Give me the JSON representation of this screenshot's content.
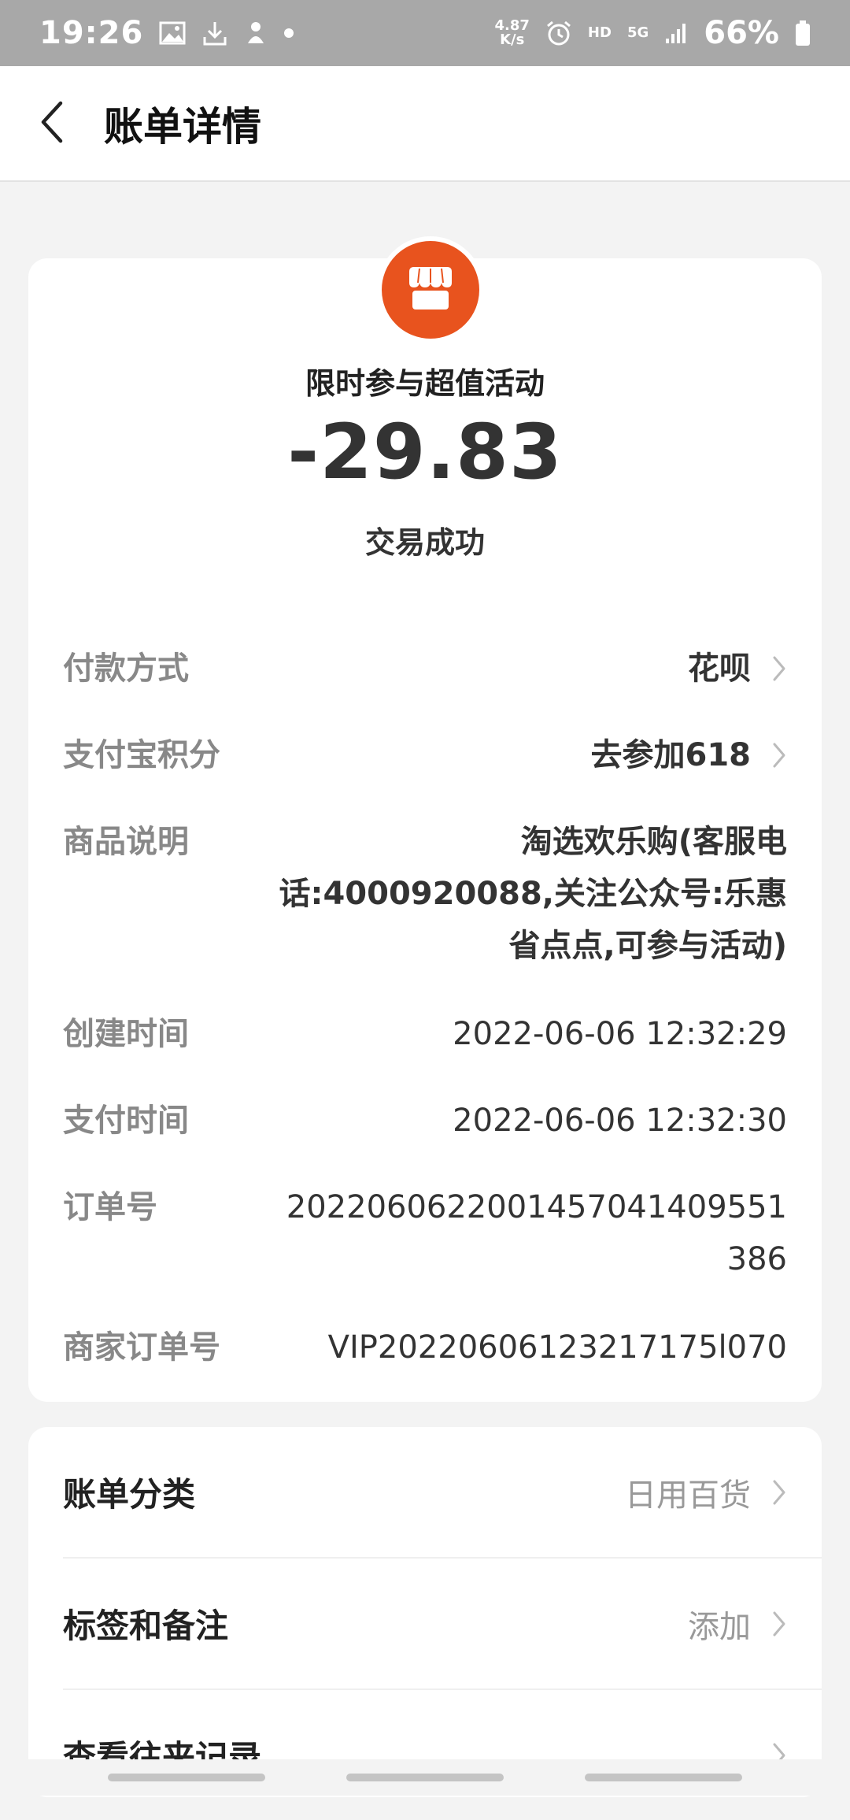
{
  "status_bar": {
    "time": "19:26",
    "speed_value": "4.87",
    "speed_unit": "K/s",
    "hd": "HD",
    "network": "5G",
    "battery": "66%",
    "icons": [
      "image-icon",
      "download-icon",
      "app-icon",
      "dot-icon",
      "alarm-icon",
      "signal-icon",
      "battery-icon"
    ]
  },
  "header": {
    "title": "账单详情",
    "back_icon": "chevron-left-icon"
  },
  "summary": {
    "merchant_icon": "store-icon",
    "merchant_color": "#e8531e",
    "merchant_name": "限时参与超值活动",
    "amount": "-29.83",
    "status": "交易成功"
  },
  "details": [
    {
      "label": "付款方式",
      "value": "花呗"
    },
    {
      "label": "支付宝积分",
      "value": "去参加618"
    },
    {
      "label": "商品说明",
      "value_lines": [
        "淘选欢乐购(客服电",
        "话:4000920088,关注公众号:乐惠",
        "省点点,可参与活动)"
      ]
    },
    {
      "label": "创建时间",
      "value": "2022-06-06 12:32:29"
    },
    {
      "label": "支付时间",
      "value": "2022-06-06 12:32:30"
    },
    {
      "label": "订单号",
      "value_lines": [
        "2022060622001457041409551",
        "386"
      ]
    },
    {
      "label": "商家订单号",
      "value": "VIP20220606123217175l070"
    }
  ],
  "actions": [
    {
      "label": "账单分类",
      "value": "日用百货"
    },
    {
      "label": "标签和备注",
      "value": "添加"
    },
    {
      "label": "查看往来记录",
      "value": ""
    }
  ]
}
